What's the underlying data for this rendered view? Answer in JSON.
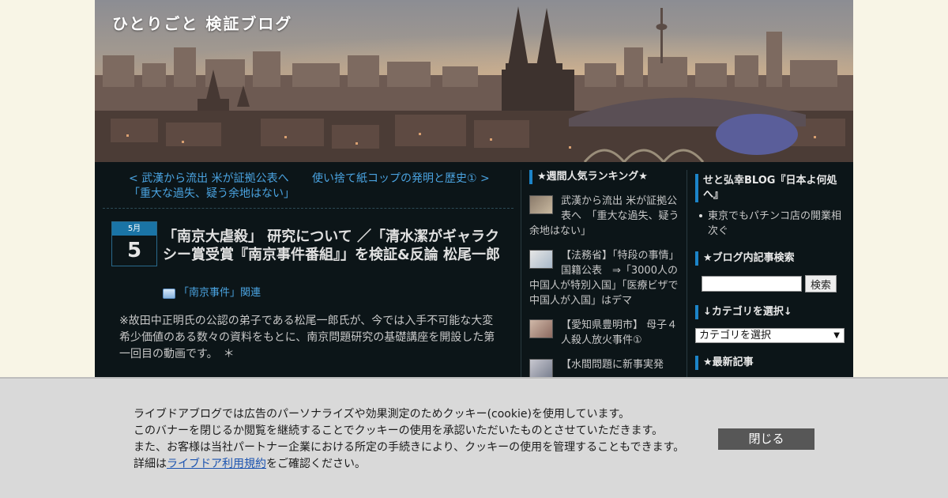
{
  "header": {
    "blog_title": "ひとりごと 検証ブログ"
  },
  "post_nav": {
    "prev": "< 武漢から流出 米が証拠公表へ　「重大な過失、疑う余地はない」",
    "next": "使い捨て紙コップの発明と歴史① >"
  },
  "post": {
    "month": "5月",
    "day": "5",
    "title": "「南京大虐殺」 研究について ／「清水潔がギャラクシー賞受賞『南京事件番組』」を検証&反論 松尾一郎",
    "category": "「南京事件」関連",
    "body": "※故田中正明氏の公認の弟子である松尾一郎氏が、今では入手不可能な大変希少価値のある数々の資料をもとに、南京問題研究の基礎講座を開設した第一回目の動画です。　＊"
  },
  "ranking": {
    "heading": "★週間人気ランキング★",
    "items": [
      {
        "text": "武漢から流出 米が証拠公表へ　「重大な過失、疑う余地はない」"
      },
      {
        "text": "【法務省】「特段の事情」国籍公表　⇒「3000人の中国人が特別入国」「医療ビザで中国人が入国」はデマ"
      },
      {
        "text": "【愛知県豊明市】 母子４人殺人放火事件①"
      },
      {
        "text": "【水間問題に新事実発"
      }
    ]
  },
  "sidebar2": {
    "heading1": "せと弘幸BLOG『日本よ何処へ』",
    "links": [
      "東京でもパチンコ店の開業相次ぐ"
    ],
    "search_heading": "★ブログ内記事検索",
    "search_button": "検索",
    "category_heading": "↓カテゴリを選択↓",
    "category_select": "カテゴリを選択",
    "latest_heading": "★最新記事"
  },
  "cookie": {
    "line1": "ライブドアブログでは広告のパーソナライズや効果測定のためクッキー(cookie)を使用しています。",
    "line2": "このバナーを閉じるか閲覧を継続することでクッキーの使用を承認いただいたものとさせていただきます。",
    "line3": "また、お客様は当社パートナー企業における所定の手続きにより、クッキーの使用を管理することもできます。",
    "line4_prefix": "詳細は",
    "line4_link": "ライブドア利用規約",
    "line4_suffix": "をご確認ください。",
    "close": "閉じる"
  },
  "colors": {
    "page_bg": "#f8f5e6",
    "content_bg": "#0c1518",
    "link": "#4aa3e0",
    "accent": "#1c84c8",
    "cookie_bg": "#d9d9d9",
    "close_button": "#575757"
  },
  "icons": [
    "folder-icon",
    "bullet-icon",
    "dropdown-arrow-icon"
  ]
}
